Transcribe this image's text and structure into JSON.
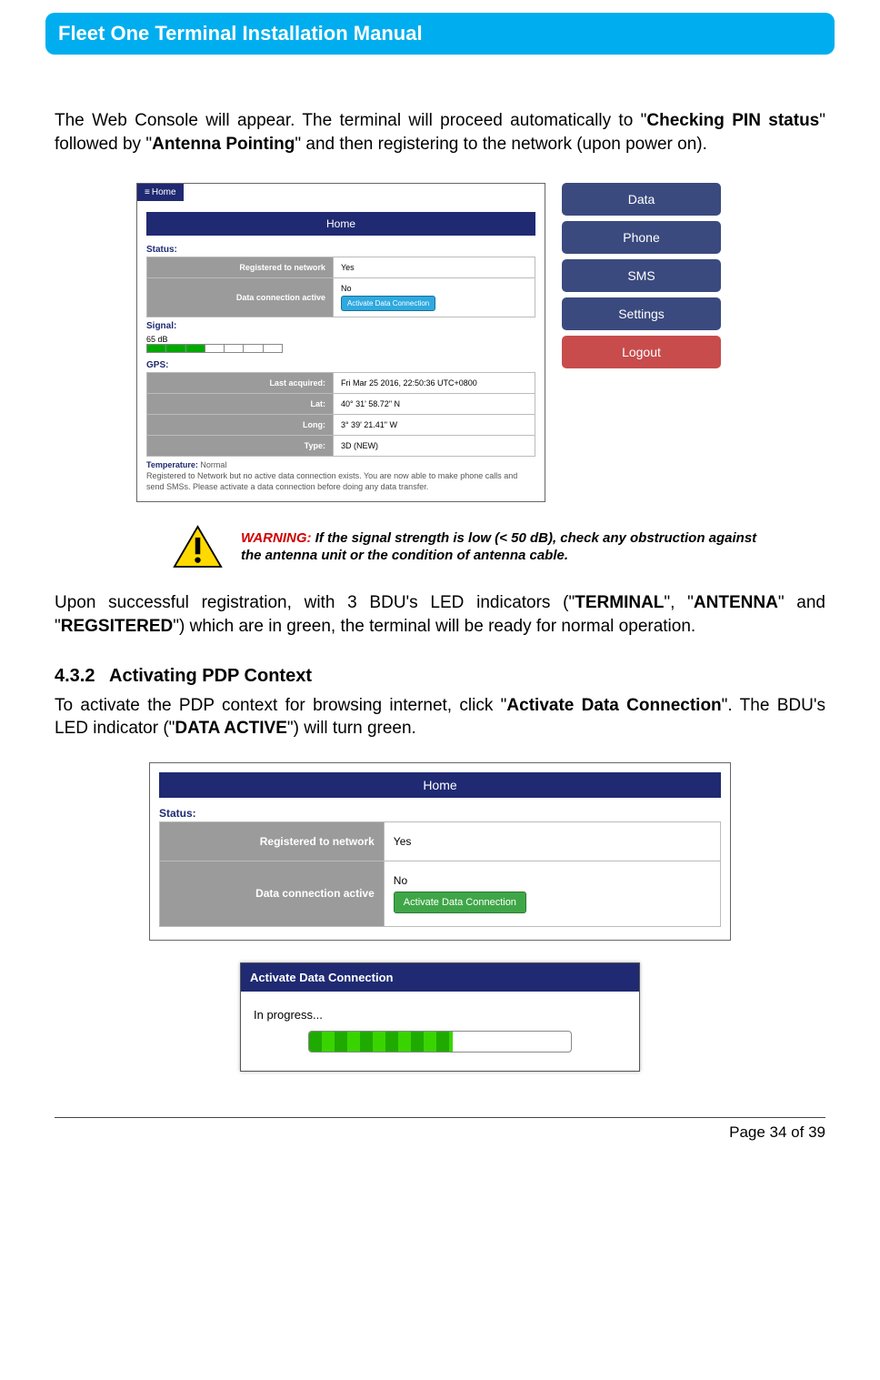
{
  "header_title": "Fleet One Terminal Installation Manual",
  "para1_prefix": "The Web Console will appear. The terminal will proceed automatically to \"",
  "para1_bold1": "Checking PIN status",
  "para1_mid": "\" followed by \"",
  "para1_bold2": "Antenna Pointing",
  "para1_suffix": "\" and then registering to the network (upon power on).",
  "shot1": {
    "home_tab": "Home",
    "bluebar": "Home",
    "status_lbl": "Status:",
    "row_reg_k": "Registered to network",
    "row_reg_v": "Yes",
    "row_data_k": "Data connection active",
    "row_data_v": "No",
    "activate_btn": "Activate Data Connection",
    "signal_lbl": "Signal:",
    "signal_val": "65 dB",
    "gps_lbl": "GPS:",
    "gps_last_k": "Last acquired:",
    "gps_last_v": "Fri Mar 25 2016, 22:50:36 UTC+0800",
    "gps_lat_k": "Lat:",
    "gps_lat_v": "40° 31' 58.72\" N",
    "gps_long_k": "Long:",
    "gps_long_v": "3° 39' 21.41\" W",
    "gps_type_k": "Type:",
    "gps_type_v": "3D (NEW)",
    "temp_lbl": "Temperature:",
    "temp_val": "Normal",
    "note": "Registered to Network but no active data connection exists. You are now able to make phone calls and send SMSs. Please activate a data connection before doing any data transfer.",
    "right_buttons": [
      "Data",
      "Phone",
      "SMS",
      "Settings",
      "Logout"
    ]
  },
  "warning_prefix": "WARNING:",
  "warning_body": " If the signal strength is low (< 50 dB), check any obstruction against the antenna unit or the condition of antenna cable.",
  "para2_prefix": "Upon successful registration, with 3 BDU's LED indicators (\"",
  "para2_b1": "TERMINAL",
  "para2_m1": "\", \"",
  "para2_b2": "ANTENNA",
  "para2_m2": "\" and \"",
  "para2_b3": "REGSITERED",
  "para2_suffix": "\") which are in green, the terminal will be ready for normal operation.",
  "sec_num": "4.3.2",
  "sec_title": "Activating PDP Context",
  "para3_prefix": "To activate the PDP context for browsing internet, click \"",
  "para3_b1": "Activate Data Connection",
  "para3_mid": "\". The BDU's LED indicator (\"",
  "para3_b2": "DATA ACTIVE",
  "para3_suffix": "\") will turn green.",
  "shot2": {
    "bluebar": "Home",
    "status_lbl": "Status:",
    "row_reg_k": "Registered to network",
    "row_reg_v": "Yes",
    "row_data_k": "Data connection active",
    "row_data_v": "No",
    "activate_btn": "Activate Data Connection",
    "dlg_title": "Activate Data Connection",
    "dlg_body": "In progress..."
  },
  "footer": "Page 34 of 39"
}
